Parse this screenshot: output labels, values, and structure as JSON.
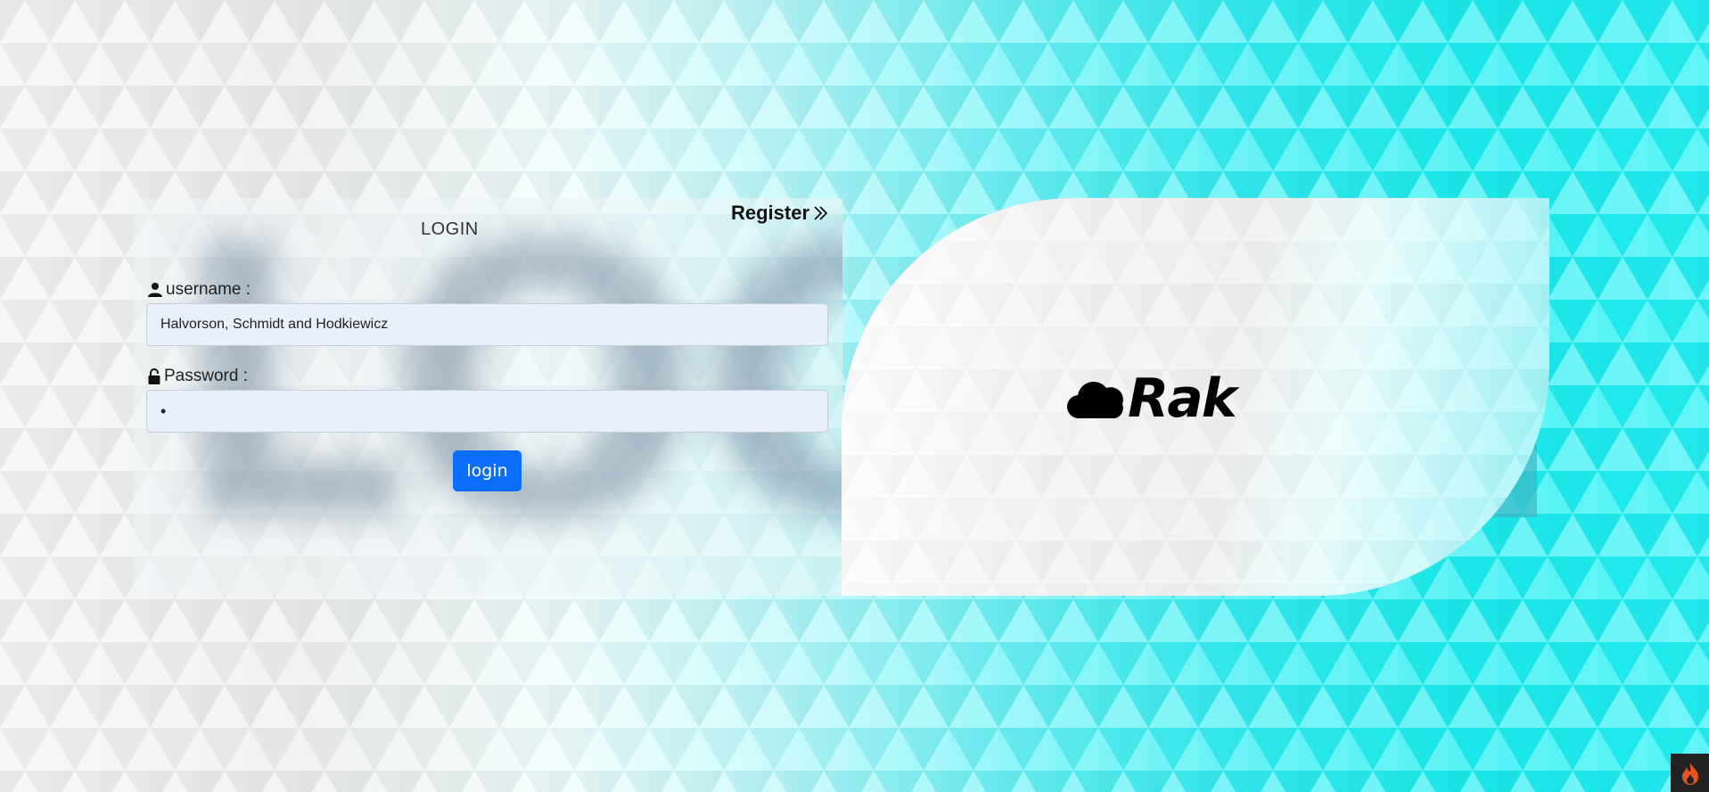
{
  "login_form": {
    "title": "LOGIN",
    "register_label": "Register",
    "username_label": "username :",
    "username_value": "Halvorson, Schmidt and Hodkiewicz",
    "password_label": "Password :",
    "password_value": "•",
    "submit_label": "login",
    "background_word": "LOG"
  },
  "brand": {
    "name": "Rak",
    "icon": "cloud-icon"
  },
  "corner_badge": {
    "icon": "flame-icon"
  },
  "colors": {
    "primary_button": "#0d6efd",
    "input_bg": "#e8f0fe",
    "cyan": "#1ceef0"
  }
}
